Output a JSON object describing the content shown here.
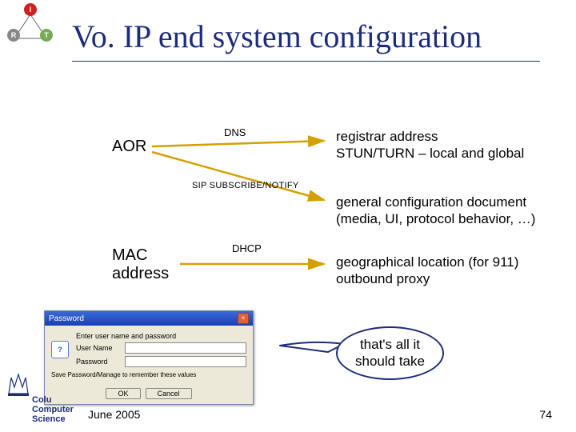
{
  "title": "Vo. IP end system configuration",
  "sources": {
    "aor": "AOR",
    "mac": "MAC\naddress"
  },
  "methods": {
    "dns": "DNS",
    "sip": "SIP SUBSCRIBE/NOTIFY",
    "dhcp": "DHCP"
  },
  "results": {
    "dns": "registrar address\nSTUN/TURN – local and global",
    "sip": "general configuration document\n(media, UI, protocol behavior, …)",
    "dhcp": "geographical location (for 911)\noutbound proxy"
  },
  "callout": "that's all it\nshould take",
  "footer": {
    "date": "June 2005",
    "page": "74"
  },
  "irt": {
    "i": "I",
    "r": "R",
    "t": "T"
  },
  "dialog": {
    "title": "Password",
    "prompt": "Enter user name and password",
    "user_label": "User Name",
    "pass_label": "Password",
    "save_label": "Save Password/Manage to remember these values",
    "ok": "OK",
    "cancel": "Cancel"
  },
  "logo": {
    "line1": "Colu",
    "line2": "Computer",
    "line3": "Science"
  },
  "colors": {
    "arrow": "#d4a000",
    "title": "#1d2d7a"
  }
}
